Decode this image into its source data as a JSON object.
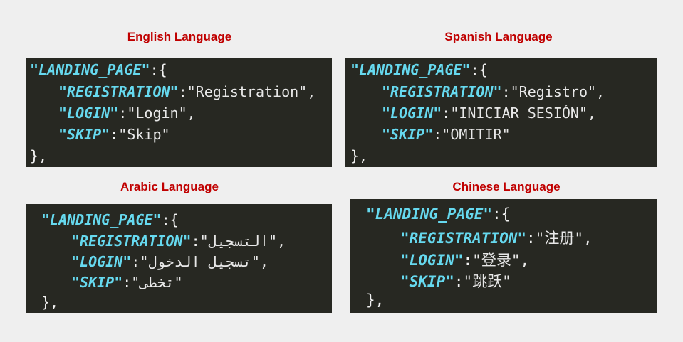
{
  "panels": [
    {
      "title": "English Language",
      "root_key": "\"LANDING_PAGE\"",
      "open": ":{",
      "rows": [
        {
          "key": "\"REGISTRATION\"",
          "value": "\"Registration\","
        },
        {
          "key": "\"LOGIN\"",
          "value": "\"Login\","
        },
        {
          "key": "\"SKIP\"",
          "value": "\"Skip\""
        }
      ],
      "close": "},"
    },
    {
      "title": "Spanish Language",
      "root_key": "\"LANDING_PAGE\"",
      "open": ":{",
      "rows": [
        {
          "key": "\"REGISTRATION\"",
          "value": "\"Registro\","
        },
        {
          "key": "\"LOGIN\"",
          "value": "\"INICIAR SESIÓN\","
        },
        {
          "key": "\"SKIP\"",
          "value": "\"OMITIR\""
        }
      ],
      "close": "},"
    },
    {
      "title": "Arabic Language",
      "root_key": "\"LANDING_PAGE\"",
      "open": ":{",
      "rows": [
        {
          "key": "\"REGISTRATION\"",
          "value": "\"التسجيل\","
        },
        {
          "key": "\"LOGIN\"",
          "value": "\"تسجيل الدخول\","
        },
        {
          "key": "\"SKIP\"",
          "value": "\"تخطى\""
        }
      ],
      "close": "},"
    },
    {
      "title": "Chinese Language",
      "root_key": "\"LANDING_PAGE\"",
      "open": ":{",
      "rows": [
        {
          "key": "\"REGISTRATION\"",
          "value": "\"注册\","
        },
        {
          "key": "\"LOGIN\"",
          "value": "\"登录\","
        },
        {
          "key": "\"SKIP\"",
          "value": "\"跳跃\""
        }
      ],
      "close": "},"
    }
  ],
  "colors": {
    "background": "#efefef",
    "title": "#c00000",
    "panel": "#272822",
    "key": "#66d9ef",
    "text": "#f2f2f2"
  }
}
